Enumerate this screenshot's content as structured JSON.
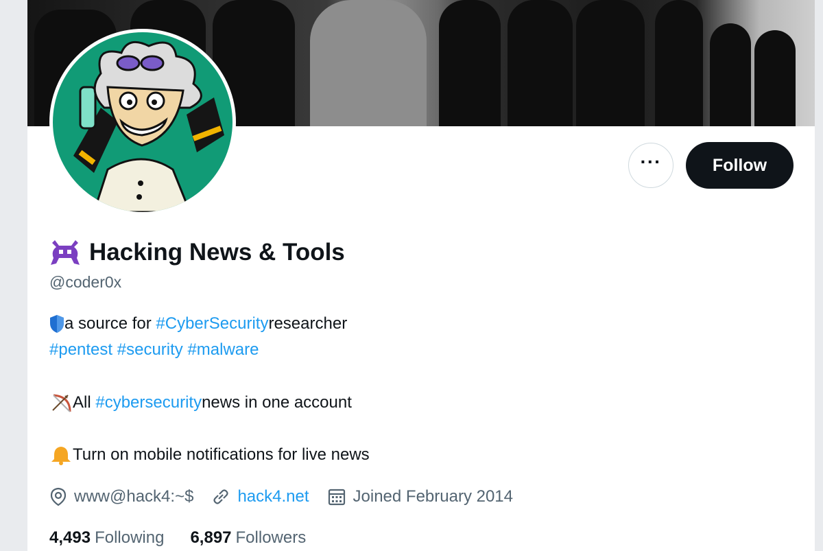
{
  "profile": {
    "display_name": "Hacking News & Tools",
    "handle": "@coder0x",
    "name_emoji_icon": "alien-monster-icon",
    "bio": {
      "line1_prefix": "a source for ",
      "line1_hashtag": "#CyberSecurity",
      "line1_suffix": " researcher",
      "line2_hashtags": "#pentest #security #malware",
      "line3_prefix": " All ",
      "line3_hashtag": "#cybersecurity",
      "line3_suffix": " news in one account",
      "line4_text": " Turn on mobile notifications for live news"
    },
    "location": "www@hack4:~$",
    "website": "hack4.net",
    "joined": "Joined February 2014",
    "following_count": "4,493",
    "following_label": "Following",
    "followers_count": "6,897",
    "followers_label": "Followers"
  },
  "actions": {
    "more_label": "···",
    "follow_label": "Follow"
  },
  "colors": {
    "link_blue": "#1d9bf0",
    "follow_bg": "#0f1419",
    "secondary_text": "#536471"
  }
}
